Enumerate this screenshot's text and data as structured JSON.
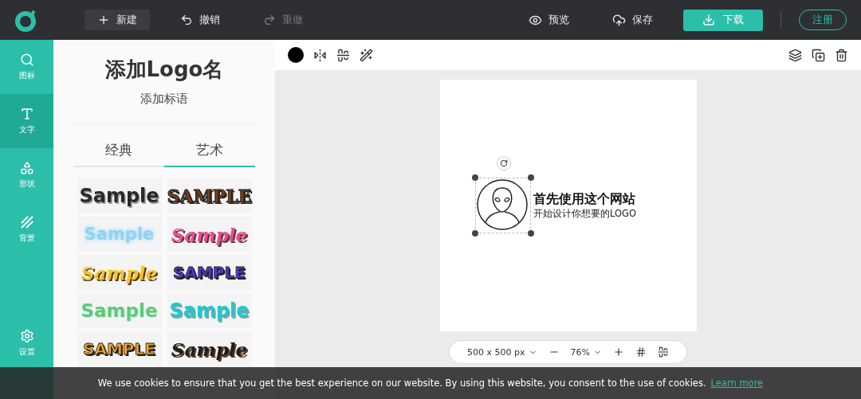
{
  "topbar": {
    "buttons": [
      {
        "label": "新建",
        "kind": "new",
        "disabled": false
      },
      {
        "label": "撤销",
        "kind": "undo",
        "disabled": false
      },
      {
        "label": "重做",
        "kind": "redo",
        "disabled": true
      }
    ],
    "actions": [
      {
        "label": "预览",
        "kind": "preview"
      },
      {
        "label": "保存",
        "kind": "save"
      }
    ],
    "download": "下载",
    "register": "注册"
  },
  "rail": {
    "items": [
      {
        "label": "图标",
        "kind": "icons",
        "selected": false
      },
      {
        "label": "文字",
        "kind": "text",
        "selected": true
      },
      {
        "label": "形状",
        "kind": "shapes",
        "selected": false
      },
      {
        "label": "背景",
        "kind": "background",
        "selected": false
      }
    ],
    "settings": "设置"
  },
  "panel": {
    "title": "添加Logo名",
    "subtitle": "添加标语",
    "tabs": [
      {
        "label": "经典",
        "selected": false
      },
      {
        "label": "艺术",
        "selected": true
      }
    ],
    "styles": [
      {
        "text": "Sample",
        "kind": "outline",
        "color": "#2a2a2a"
      },
      {
        "text": "SAMPLE",
        "kind": "serif",
        "color": "#7a3e12"
      },
      {
        "text": "Sample",
        "kind": "glow",
        "color": "#8fd3f4"
      },
      {
        "text": "Sample",
        "kind": "script",
        "color": "#e84c9a"
      },
      {
        "text": "Sample",
        "kind": "script",
        "color": "#f7c520"
      },
      {
        "text": "SAMPLE",
        "kind": "block",
        "color": "#4a3ad8"
      },
      {
        "text": "Sample",
        "kind": "soft",
        "color": "#5cc97a"
      },
      {
        "text": "Sample",
        "kind": "outline",
        "color": "#1bc9d0"
      },
      {
        "text": "SAMPLE",
        "kind": "block",
        "color": "#f5a623"
      },
      {
        "text": "Sample",
        "kind": "script",
        "color": "#1e1e1e"
      }
    ]
  },
  "canvas": {
    "logo": {
      "title": "首先使用这个网站",
      "tagline": "开始设计你想要的LOGO",
      "selected": true
    },
    "size": "500 x 500 px",
    "zoom": "76%"
  },
  "cookie": {
    "message": "We use cookies to ensure that you get the best experience on our website. By using this website, you consent to the use of cookies.",
    "link": "Learn more"
  }
}
